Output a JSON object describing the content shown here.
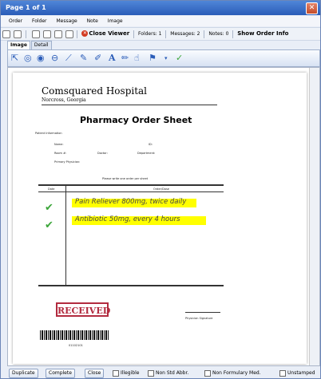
{
  "window": {
    "title": "Page 1 of 1"
  },
  "menu": [
    "Order",
    "Folder",
    "Message",
    "Note",
    "Image"
  ],
  "toolbar": {
    "close_viewer": "Close Viewer",
    "folders": "Folders: 1",
    "messages": "Messages: 2",
    "notes": "Notes: 0",
    "show_order_info": "Show Order Info"
  },
  "tabs": [
    "Image",
    "Detail"
  ],
  "document": {
    "hospital": "Comsquared Hospital",
    "address": "Norcross, Georgia",
    "title": "Pharmacy Order Sheet",
    "patient_info": "Patient Information",
    "name_label": "Name:",
    "id_label": "ID:",
    "room_label": "Room #:",
    "doctor_label": "Doctor:",
    "department_label": "Department:",
    "physician_label": "Primary Physician:",
    "instruction": "Please write one order per sheet",
    "col_date": "Date",
    "col_order": "Order/Dose",
    "orders": [
      "Pain Reliever 800mg, twice daily",
      "Antibiotic 50mg, every 4 hours"
    ],
    "stamp": "RECEIVED",
    "barcode_number": "01102101",
    "signature_label": "Physician Signature"
  },
  "bottom": {
    "duplicate": "Duplicate",
    "complete": "Complete",
    "close": "Close",
    "illegible": "Illegible",
    "non_std": "Non Std Abbr.",
    "non_formulary": "Non Formulary Med.",
    "unstamped": "Unstamped"
  },
  "colors": {
    "title_bar": "#2a5cb8",
    "highlight": "#ffff00",
    "stamp": "#b22b3f",
    "check": "#3ca63a"
  }
}
